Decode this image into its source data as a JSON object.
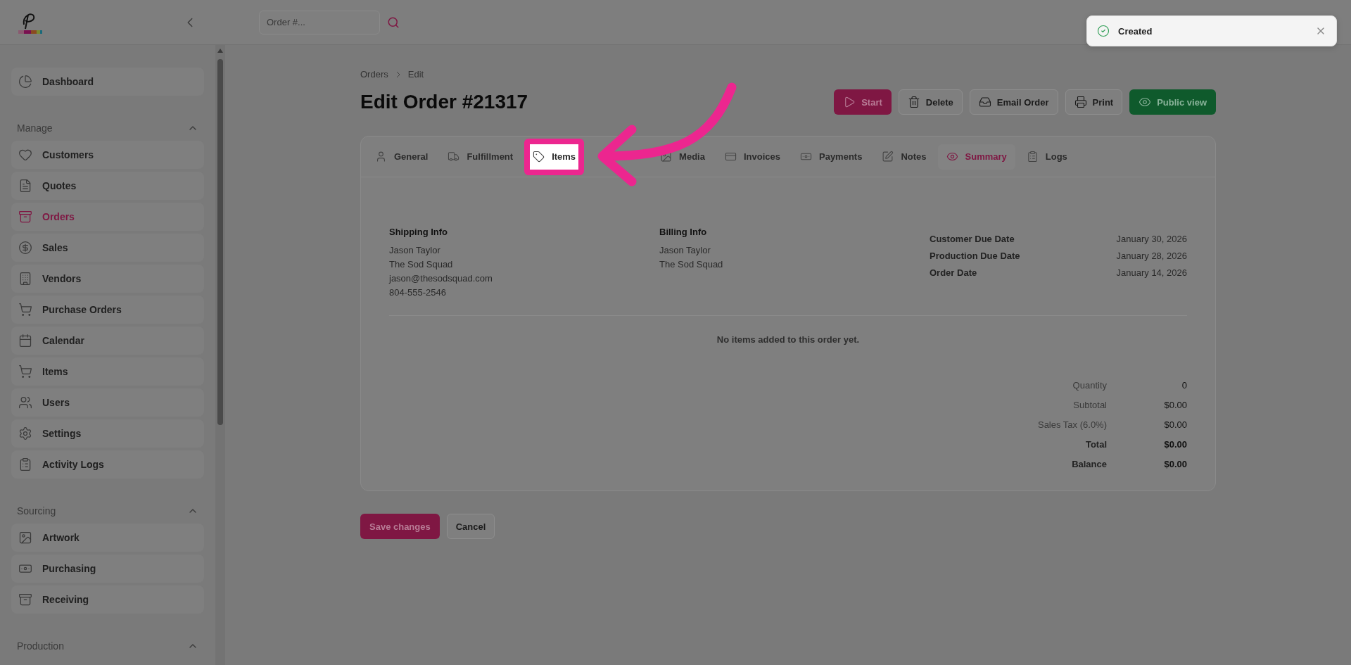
{
  "header": {
    "search": {
      "placeholder": "Order #..."
    }
  },
  "toast": {
    "message": "Created"
  },
  "sidebar": {
    "top_items": [
      {
        "label": "Dashboard",
        "selected": false
      }
    ],
    "sections": [
      {
        "title": "Manage",
        "expanded": true,
        "items": [
          {
            "label": "Customers",
            "selected": false
          },
          {
            "label": "Quotes",
            "selected": false
          },
          {
            "label": "Orders",
            "selected": true
          },
          {
            "label": "Sales",
            "selected": false
          },
          {
            "label": "Vendors",
            "selected": false
          },
          {
            "label": "Purchase Orders",
            "selected": false
          },
          {
            "label": "Calendar",
            "selected": false
          },
          {
            "label": "Items",
            "selected": false
          },
          {
            "label": "Users",
            "selected": false
          },
          {
            "label": "Settings",
            "selected": false
          },
          {
            "label": "Activity Logs",
            "selected": false
          }
        ]
      },
      {
        "title": "Sourcing",
        "expanded": true,
        "items": [
          {
            "label": "Artwork",
            "selected": false
          },
          {
            "label": "Purchasing",
            "selected": false
          },
          {
            "label": "Receiving",
            "selected": false
          }
        ]
      },
      {
        "title": "Production",
        "expanded": true
      }
    ]
  },
  "breadcrumb": [
    "Orders",
    "Edit"
  ],
  "title": "Edit Order #21317",
  "actions": [
    {
      "label": "Start",
      "kind": "primary"
    },
    {
      "label": "Delete",
      "kind": "default"
    },
    {
      "label": "Email Order",
      "kind": "default"
    },
    {
      "label": "Print",
      "kind": "default"
    },
    {
      "label": "Public view",
      "kind": "success"
    }
  ],
  "tabs": [
    {
      "label": "General",
      "selected": false,
      "highlighted": false
    },
    {
      "label": "Fulfillment",
      "selected": false,
      "highlighted": false
    },
    {
      "label": "Items",
      "selected": false,
      "highlighted": true
    },
    {
      "label": "Media",
      "selected": false,
      "highlighted": false
    },
    {
      "label": "Invoices",
      "selected": false,
      "highlighted": false
    },
    {
      "label": "Payments",
      "selected": false,
      "highlighted": false
    },
    {
      "label": "Notes",
      "selected": false,
      "highlighted": false
    },
    {
      "label": "Summary",
      "selected": true,
      "highlighted": false
    },
    {
      "label": "Logs",
      "selected": false,
      "highlighted": false
    }
  ],
  "shipping": {
    "title": "Shipping Info",
    "lines": [
      "Jason Taylor",
      "The Sod Squad",
      "jason@thesodsquad.com",
      "804-555-2546"
    ]
  },
  "billing": {
    "title": "Billing Info",
    "lines": [
      "Jason Taylor",
      "The Sod Squad"
    ]
  },
  "dates": [
    {
      "label": "Customer Due Date",
      "value": "January 30, 2026"
    },
    {
      "label": "Production Due Date",
      "value": "January 28, 2026"
    },
    {
      "label": "Order Date",
      "value": "January 14, 2026"
    }
  ],
  "empty_message": "No items added to this order yet.",
  "totals": [
    {
      "label": "Quantity",
      "value": "0",
      "emphasis": false
    },
    {
      "label": "Subtotal",
      "value": "$0.00",
      "emphasis": false
    },
    {
      "label": "Sales Tax (6.0%)",
      "value": "$0.00",
      "emphasis": false
    },
    {
      "label": "Total",
      "value": "$0.00",
      "emphasis": true
    },
    {
      "label": "Balance",
      "value": "$0.00",
      "emphasis": true
    }
  ],
  "footer_buttons": [
    {
      "label": "Save changes",
      "kind": "primary"
    },
    {
      "label": "Cancel",
      "kind": "default"
    }
  ]
}
